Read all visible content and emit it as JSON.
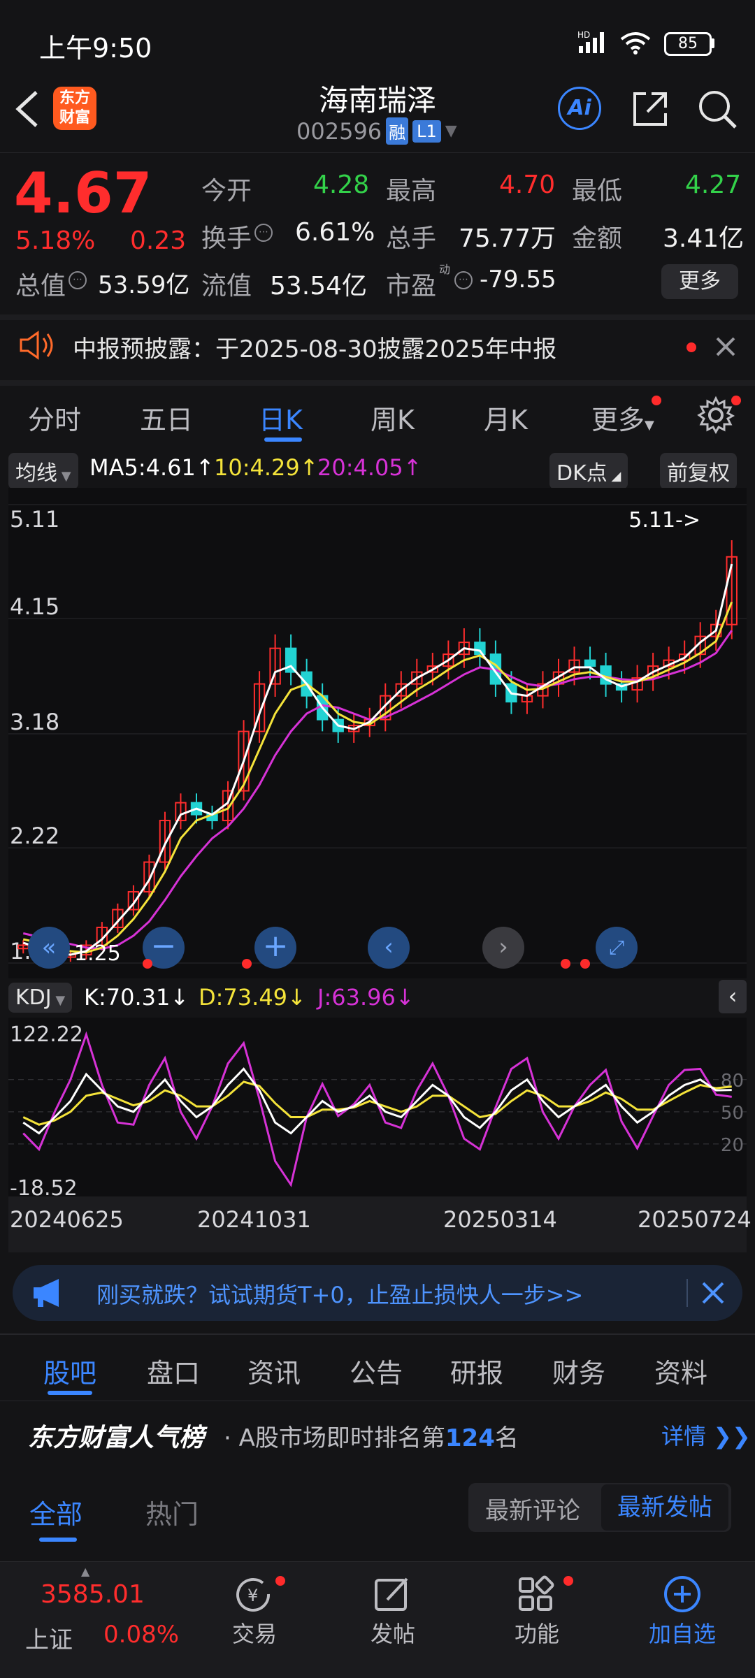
{
  "status": {
    "time": "上午9:50",
    "battery": "85"
  },
  "header": {
    "title": "海南瑞泽",
    "code": "002596",
    "tag_rong": "融",
    "tag_level": "L1",
    "logo_line1": "东方",
    "logo_line2": "财富",
    "ai_label": "Ai"
  },
  "quote": {
    "price": "4.67",
    "pct": "5.18%",
    "chg": "0.23",
    "open_label": "今开",
    "open": "4.28",
    "high_label": "最高",
    "high": "4.70",
    "low_label": "最低",
    "low": "4.27",
    "turnover_label": "换手",
    "turnover": "6.61%",
    "volume_label": "总手",
    "volume": "75.77万",
    "amount_label": "金额",
    "amount": "3.41亿",
    "mktcap_label": "总值",
    "mktcap": "53.59亿",
    "float_label": "流值",
    "float": "53.54亿",
    "pe_label": "市盈",
    "pe_sup": "动",
    "pe": "-79.55",
    "more_label": "更多"
  },
  "notice": {
    "text": "中报预披露：于2025-08-30披露2025年中报"
  },
  "chart_tabs": [
    "分时",
    "五日",
    "日K",
    "周K",
    "月K",
    "更多"
  ],
  "chart_toolbar": {
    "ma_selector": "均线",
    "ma5": "MA5:4.61",
    "ma10": "10:4.29",
    "ma20": "20:4.05",
    "arrow": "↑",
    "dk": "DK点",
    "fq": "前复权"
  },
  "kdj_toolbar": {
    "selector": "KDJ",
    "k": "K:70.31",
    "d": "D:73.49",
    "j": "J:63.96",
    "arrow": "↓"
  },
  "chart_data": {
    "type": "candlestick",
    "y_ticks": [
      "5.11",
      "4.15",
      "3.18",
      "2.22",
      "1.25"
    ],
    "max_label": "5.11->",
    "min_label": "<-1.25",
    "ylim": [
      1.25,
      5.11
    ],
    "kdj_ticks": [
      "122.22",
      "-18.52"
    ],
    "kdj_right_ticks": [
      "80",
      "50",
      "20"
    ],
    "x_ticks": [
      "20240625",
      "20241031",
      "20250314",
      "20250724"
    ],
    "close": [
      1.4,
      1.35,
      1.3,
      1.32,
      1.4,
      1.55,
      1.7,
      1.85,
      2.1,
      2.45,
      2.6,
      2.5,
      2.45,
      2.7,
      3.2,
      3.6,
      3.9,
      3.7,
      3.5,
      3.3,
      3.2,
      3.25,
      3.3,
      3.5,
      3.6,
      3.7,
      3.75,
      3.85,
      3.95,
      3.85,
      3.6,
      3.45,
      3.5,
      3.6,
      3.7,
      3.8,
      3.75,
      3.6,
      3.55,
      3.65,
      3.75,
      3.8,
      3.85,
      4.0,
      4.1,
      4.67
    ],
    "ma5": [
      1.42,
      1.38,
      1.34,
      1.32,
      1.35,
      1.45,
      1.6,
      1.75,
      1.95,
      2.25,
      2.5,
      2.55,
      2.5,
      2.6,
      2.95,
      3.35,
      3.7,
      3.75,
      3.6,
      3.4,
      3.25,
      3.22,
      3.28,
      3.42,
      3.55,
      3.65,
      3.72,
      3.8,
      3.9,
      3.88,
      3.7,
      3.52,
      3.5,
      3.58,
      3.66,
      3.74,
      3.74,
      3.64,
      3.58,
      3.62,
      3.7,
      3.76,
      3.82,
      3.95,
      4.05,
      4.61
    ],
    "ma10": [
      1.45,
      1.42,
      1.38,
      1.35,
      1.34,
      1.38,
      1.48,
      1.62,
      1.8,
      2.02,
      2.3,
      2.45,
      2.5,
      2.55,
      2.75,
      3.05,
      3.35,
      3.55,
      3.6,
      3.5,
      3.35,
      3.28,
      3.26,
      3.35,
      3.45,
      3.55,
      3.63,
      3.72,
      3.8,
      3.84,
      3.76,
      3.62,
      3.55,
      3.56,
      3.62,
      3.68,
      3.7,
      3.66,
      3.62,
      3.62,
      3.66,
      3.72,
      3.78,
      3.86,
      3.96,
      4.29
    ],
    "ma20": [
      1.5,
      1.47,
      1.44,
      1.41,
      1.38,
      1.37,
      1.4,
      1.48,
      1.6,
      1.78,
      1.98,
      2.15,
      2.3,
      2.4,
      2.55,
      2.75,
      3.0,
      3.2,
      3.35,
      3.42,
      3.4,
      3.35,
      3.3,
      3.32,
      3.38,
      3.45,
      3.52,
      3.6,
      3.68,
      3.74,
      3.72,
      3.66,
      3.6,
      3.58,
      3.6,
      3.64,
      3.66,
      3.66,
      3.64,
      3.63,
      3.64,
      3.68,
      3.72,
      3.78,
      3.86,
      4.05
    ],
    "k": [
      40,
      30,
      45,
      60,
      85,
      70,
      55,
      50,
      65,
      80,
      60,
      45,
      55,
      75,
      90,
      70,
      40,
      30,
      45,
      60,
      50,
      55,
      65,
      50,
      45,
      60,
      75,
      65,
      45,
      35,
      50,
      70,
      80,
      60,
      45,
      55,
      65,
      75,
      55,
      40,
      50,
      65,
      75,
      80,
      70,
      70.31
    ],
    "d": [
      45,
      38,
      42,
      50,
      65,
      68,
      62,
      56,
      60,
      70,
      65,
      55,
      55,
      65,
      78,
      74,
      58,
      45,
      45,
      52,
      52,
      54,
      60,
      55,
      50,
      55,
      65,
      65,
      55,
      45,
      48,
      60,
      70,
      65,
      55,
      55,
      60,
      68,
      62,
      52,
      52,
      60,
      68,
      75,
      72,
      73.49
    ],
    "j": [
      30,
      15,
      50,
      80,
      122,
      75,
      40,
      38,
      75,
      100,
      50,
      25,
      55,
      95,
      114,
      62,
      4,
      -18,
      45,
      76,
      46,
      57,
      75,
      40,
      35,
      70,
      95,
      65,
      25,
      15,
      54,
      90,
      100,
      50,
      25,
      55,
      75,
      89,
      41,
      16,
      46,
      75,
      89,
      90,
      66,
      63.96
    ]
  },
  "ad_banner": {
    "text": "刚买就跌？试试期货T+0，止盈止损快人一步>>"
  },
  "section_tabs": [
    "股吧",
    "盘口",
    "资讯",
    "公告",
    "研报",
    "财务",
    "资料"
  ],
  "ranking": {
    "brand": "东方财富人气榜",
    "prefix": "· A股市场即时排名第",
    "rank": "124",
    "suffix": "名",
    "detail": "详情"
  },
  "feed_tabs": {
    "all": "全部",
    "hot": "热门",
    "latest_comment": "最新评论",
    "latest_post": "最新发帖"
  },
  "bottom_nav": {
    "index_value": "3585.01",
    "index_name": "上证",
    "index_pct": "0.08%",
    "trade": "交易",
    "post": "发帖",
    "func": "功能",
    "add": "加自选"
  },
  "colors": {
    "up": "#ff2d2d",
    "down": "#33d24a",
    "accent": "#3b86ff",
    "ma5": "#ffffff",
    "ma10": "#f4e33a",
    "ma20": "#d632d6"
  }
}
